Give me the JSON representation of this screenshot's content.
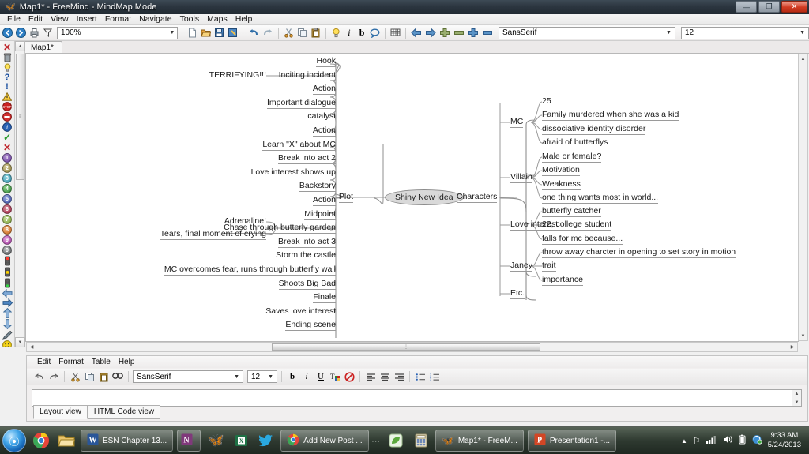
{
  "window": {
    "title": "Map1* - FreeMind - MindMap Mode",
    "app_icon": "butterfly-icon",
    "buttons": {
      "minimize": "—",
      "maximize": "❐",
      "close": "✕"
    }
  },
  "menubar": {
    "items": [
      "File",
      "Edit",
      "View",
      "Insert",
      "Format",
      "Navigate",
      "Tools",
      "Maps",
      "Help"
    ]
  },
  "toolbar": {
    "zoom": "100%",
    "font_family": "SansSerif",
    "font_size": "12",
    "icons": [
      "back-icon",
      "forward-icon",
      "print-icon",
      "filter-icon",
      "new-icon",
      "open-icon",
      "save-icon",
      "save-as-icon",
      "undo-icon",
      "redo-icon",
      "cut-icon",
      "copy-icon",
      "paste-icon",
      "bulb-icon",
      "italic-icon",
      "bold-icon",
      "cloud-icon",
      "grid-icon",
      "arrow-left-icon",
      "arrow-right-icon",
      "plus-node-icon",
      "minus-node-icon",
      "plus-icon",
      "minus-icon"
    ]
  },
  "map_tab": {
    "label": "Map1*"
  },
  "icon_rail": {
    "items": [
      "remove-icon",
      "trash-icon",
      "idea-icon",
      "question-icon",
      "exclamation-icon",
      "warning-icon",
      "stop-icon",
      "forbidden-icon",
      "info-icon",
      "check-icon",
      "cross-icon",
      "number-1-icon",
      "number-2-icon",
      "number-3-icon",
      "number-4-icon",
      "number-5-icon",
      "number-6-icon",
      "number-7-icon",
      "number-8-icon",
      "number-9-icon",
      "number-0-icon",
      "traffic-red-icon",
      "traffic-yellow-icon",
      "traffic-green-icon",
      "arrow-left-icon",
      "arrow-right-icon",
      "arrow-up-icon",
      "arrow-down-icon",
      "pencil-icon",
      "smiley-icon",
      "smiley2-icon"
    ]
  },
  "mindmap": {
    "root": "Shiny New Idea",
    "branches": [
      {
        "label": "Plot",
        "side": "left",
        "children": [
          {
            "label": "Hook",
            "children": []
          },
          {
            "label": "Inciting incident",
            "children": [
              "TERRIFYING!!!"
            ]
          },
          {
            "label": "Action",
            "children": []
          },
          {
            "label": "Important dialogue",
            "children": []
          },
          {
            "label": "catalyst",
            "children": []
          },
          {
            "label": "Action",
            "children": []
          },
          {
            "label": "Learn \"X\" about MC",
            "children": []
          },
          {
            "label": "Break into act 2",
            "children": []
          },
          {
            "label": "Love interest shows up",
            "children": []
          },
          {
            "label": "Backstory",
            "children": []
          },
          {
            "label": "Action",
            "children": []
          },
          {
            "label": "Midpoint",
            "children": []
          },
          {
            "label": "Chase through butterly garden",
            "children": [
              "Adrenaline!",
              "Tears, final moment of crying"
            ]
          },
          {
            "label": "Break into act 3",
            "children": []
          },
          {
            "label": "Storm the castle",
            "children": []
          },
          {
            "label": "MC overcomes fear, runs through butterfly wall",
            "children": []
          },
          {
            "label": "Shoots Big Bad",
            "children": []
          },
          {
            "label": "Finale",
            "children": []
          },
          {
            "label": "Saves love interest",
            "children": []
          },
          {
            "label": "Ending scene",
            "children": []
          }
        ]
      },
      {
        "label": "Characters",
        "side": "right",
        "children": [
          {
            "label": "MC",
            "children": [
              "25",
              "Family murdered when she was a kid",
              "dissociative identity disorder",
              "afraid of butterflys"
            ]
          },
          {
            "label": "Villain",
            "children": [
              "Male or female?",
              "Motivation",
              "Weakness",
              "one thing wants most in world..."
            ]
          },
          {
            "label": "Love interest",
            "children": [
              "butterfly catcher",
              "22, college student",
              "falls for mc because..."
            ]
          },
          {
            "label": "Janey",
            "children": [
              "throw away charcter in opening to set story in motion",
              "trait",
              "importance"
            ]
          },
          {
            "label": "Etc.",
            "children": []
          }
        ]
      }
    ]
  },
  "note_editor": {
    "menu": [
      "Edit",
      "Format",
      "Table",
      "Help"
    ],
    "font_family": "SansSerif",
    "font_size": "12",
    "content": "",
    "icons": [
      "undo-icon",
      "redo-icon",
      "cut-icon",
      "copy-icon",
      "paste-icon",
      "find-icon",
      "bold-icon",
      "italic-icon",
      "underline-icon",
      "text-color-icon",
      "clear-format-icon",
      "align-left-icon",
      "align-center-icon",
      "align-right-icon",
      "bullet-list-icon",
      "number-list-icon"
    ],
    "tabs": [
      {
        "label": "Layout view",
        "active": true
      },
      {
        "label": "HTML Code view",
        "active": false
      }
    ]
  },
  "taskbar": {
    "start": "start-orb-icon",
    "quick_launch": [
      "chrome-icon",
      "explorer-icon"
    ],
    "items": [
      {
        "label": "ESN Chapter 13...",
        "icon": "word-icon"
      },
      {
        "label": "",
        "icon": "onenote-icon"
      },
      {
        "label": "",
        "icon": "butterfly-icon"
      },
      {
        "label": "",
        "icon": "excel-icon"
      },
      {
        "label": "",
        "icon": "twitter-icon"
      },
      {
        "label": "Add New Post ...",
        "icon": "chrome-icon"
      },
      {
        "label": "",
        "icon": "leaf-icon"
      },
      {
        "label": "",
        "icon": "calculator-icon"
      },
      {
        "label": "Map1* - FreeM...",
        "icon": "butterfly-icon"
      },
      {
        "label": "Presentation1 -...",
        "icon": "powerpoint-icon"
      }
    ],
    "tray": [
      "show-hidden-icon",
      "flag-icon",
      "network-icon",
      "volume-icon",
      "battery-icon",
      "sync-icon"
    ],
    "clock_time": "9:33 AM",
    "clock_date": "5/24/2013"
  }
}
